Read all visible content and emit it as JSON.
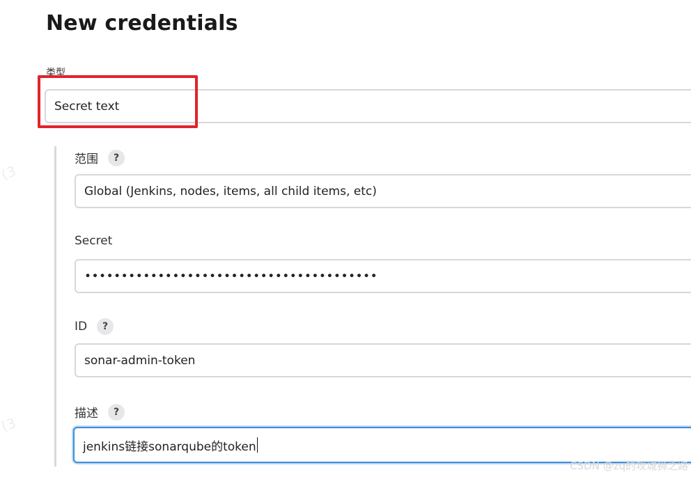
{
  "page": {
    "title": "New credentials"
  },
  "kind": {
    "label": "类型",
    "value": "Secret text"
  },
  "scope": {
    "label": "范围",
    "value": "Global (Jenkins, nodes, items, all child items, etc)"
  },
  "secret": {
    "label": "Secret",
    "value": "••••••••••••••••••••••••••••••••••••••••"
  },
  "id": {
    "label": "ID",
    "value": "sonar-admin-token"
  },
  "description": {
    "label": "描述",
    "value": "jenkins链接sonarqube的token"
  },
  "help": {
    "glyph": "?"
  },
  "watermark": "CSDN @zq的攻城狮之路",
  "background_marks": [
    "(3",
    "(3"
  ],
  "colors": {
    "highlight": "#e2232a",
    "focus_border": "#3f8ed8"
  }
}
